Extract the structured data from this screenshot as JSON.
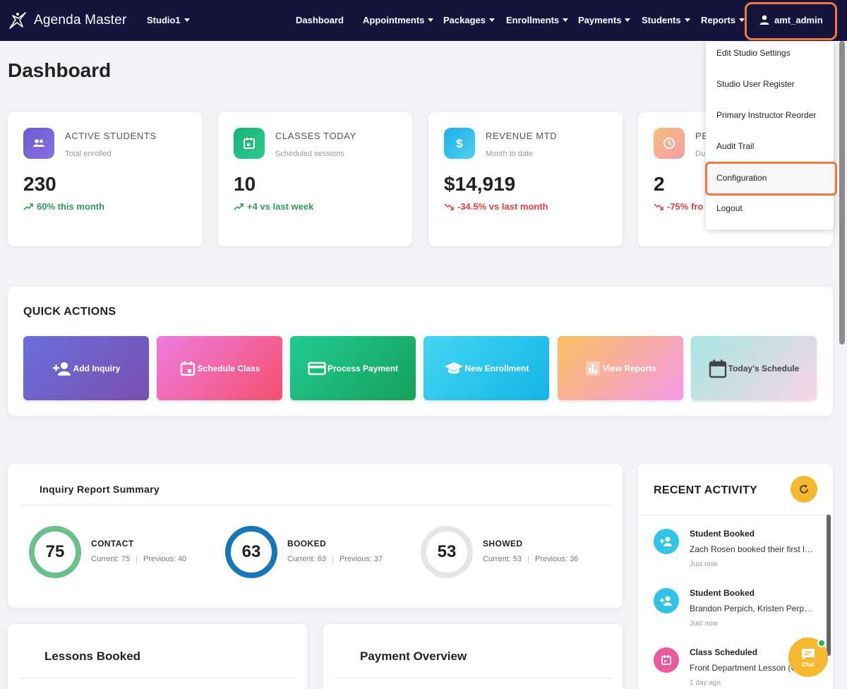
{
  "brand": {
    "name": "Agenda Master",
    "logo_icon": "dancer-logo-icon"
  },
  "nav": {
    "studio": "Studio1",
    "items": [
      {
        "label": "Dashboard",
        "has_caret": false
      },
      {
        "label": "Appointments",
        "has_caret": true
      },
      {
        "label": "Packages",
        "has_caret": true
      },
      {
        "label": "Enrollments",
        "has_caret": true
      },
      {
        "label": "Payments",
        "has_caret": true
      },
      {
        "label": "Students",
        "has_caret": true
      },
      {
        "label": "Reports",
        "has_caret": true
      }
    ],
    "user": "amt_admin"
  },
  "page_title": "Dashboard",
  "stats": [
    {
      "label": "ACTIVE STUDENTS",
      "sub": "Total enrolled",
      "value": "230",
      "trend": "60% this month",
      "direction": "up",
      "icon": "users-icon",
      "color": "#6a5bd0"
    },
    {
      "label": "CLASSES TODAY",
      "sub": "Scheduled sessions",
      "value": "10",
      "trend": "+4 vs last week",
      "direction": "up",
      "icon": "calendar-icon",
      "color": "#1fb57c"
    },
    {
      "label": "REVENUE MTD",
      "sub": "Month to date",
      "value": "$14,919",
      "trend": "-34.5% vs last month",
      "direction": "down",
      "icon": "dollar-icon",
      "color": "#29b6ea"
    },
    {
      "label": "PE",
      "sub": "Du",
      "value": "2",
      "trend": "-75% fro",
      "direction": "down",
      "icon": "clock-icon",
      "color": "#f7a58a"
    }
  ],
  "quick_actions": {
    "title": "QUICK ACTIONS",
    "buttons": [
      {
        "label": "Add Inquiry",
        "icon": "add-user-icon"
      },
      {
        "label": "Schedule Class",
        "icon": "calendar-icon"
      },
      {
        "label": "Process Payment",
        "icon": "credit-card-icon"
      },
      {
        "label": "New Enrollment",
        "icon": "graduation-cap-icon"
      },
      {
        "label": "View Reports",
        "icon": "bar-chart-icon"
      },
      {
        "label": "Today's Schedule",
        "icon": "calendar-icon"
      }
    ]
  },
  "inquiry": {
    "title": "Inquiry Report Summary",
    "items": [
      {
        "value": "75",
        "label": "CONTACT",
        "current": "Current: 75",
        "previous": "Previous: 40",
        "color": "#6cc08b"
      },
      {
        "value": "63",
        "label": "BOOKED",
        "current": "Current: 63",
        "previous": "Previous: 37",
        "color": "#1876bd"
      },
      {
        "value": "53",
        "label": "SHOWED",
        "current": "Current: 53",
        "previous": "Previous: 36",
        "color": "#e6e6e6"
      }
    ]
  },
  "lessons_title": "Lessons Booked",
  "payment_title": "Payment Overview",
  "recent_activity": {
    "title": "RECENT ACTIVITY",
    "items": [
      {
        "title": "Student Booked",
        "desc": "Zach Rosen booked their first lesson",
        "time": "Just now",
        "icon": "add-user-icon",
        "color": "#33c3e8"
      },
      {
        "title": "Student Booked",
        "desc": "Brandon Perpich, Kristen Perpich booked",
        "time": "Just now",
        "icon": "add-user-icon",
        "color": "#33c3e8"
      },
      {
        "title": "Class Scheduled",
        "desc": "Front Department Lesson (Group)",
        "time": "1 day ago",
        "icon": "calendar-icon",
        "color": "#ee5aa0"
      }
    ]
  },
  "user_menu": [
    "Edit Studio Settings",
    "Studio User Register",
    "Primary Instructor Reorder",
    "Audit Trail",
    "Configuration",
    "Logout"
  ],
  "chat": {
    "label": "Chat",
    "icon": "chat-icon"
  }
}
